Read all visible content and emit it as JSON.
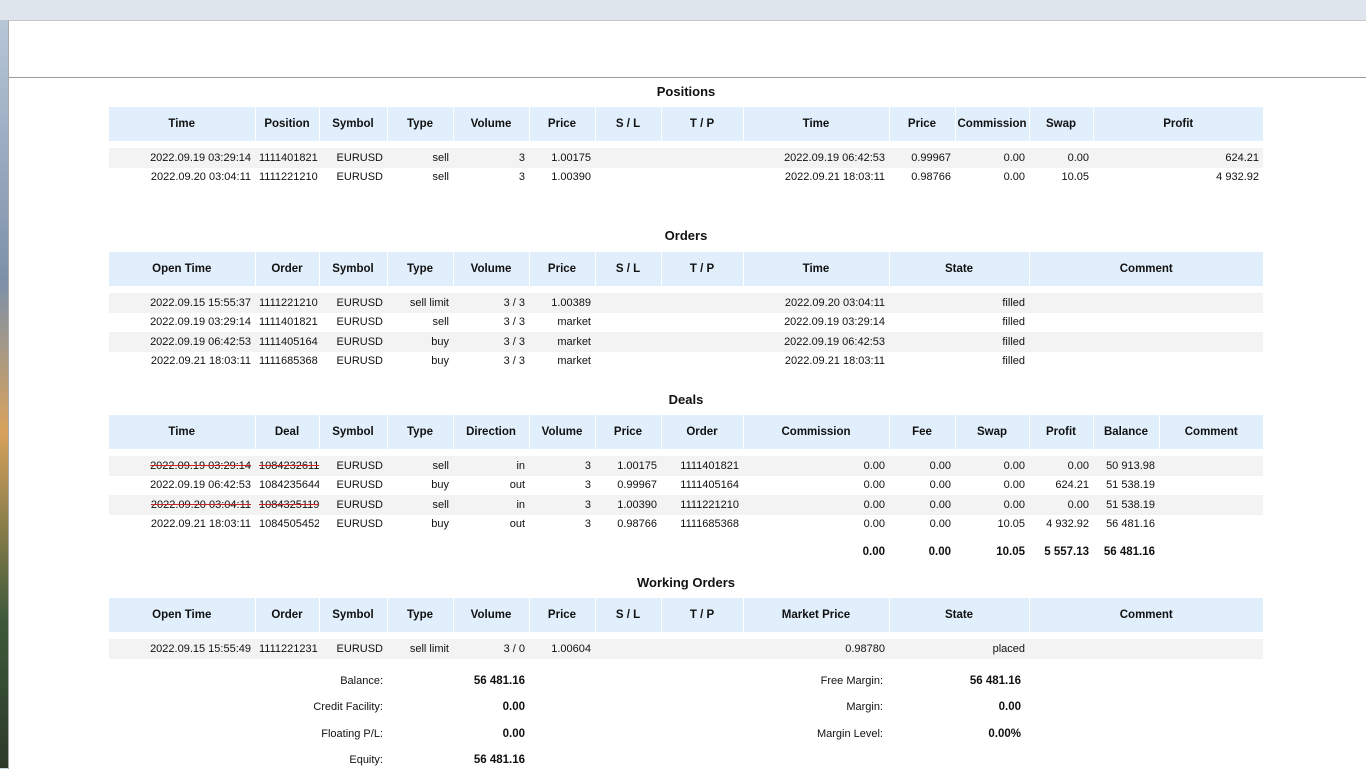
{
  "positions": {
    "title": "Positions",
    "headers": [
      "Time",
      "Position",
      "Symbol",
      "Type",
      "Volume",
      "Price",
      "S / L",
      "T / P",
      "Time",
      "Price",
      "Commission",
      "Swap",
      "Profit"
    ],
    "rows": [
      [
        "2022.09.19 03:29:14",
        "1111401821",
        "EURUSD",
        "sell",
        "3",
        "1.00175",
        "",
        "",
        "2022.09.19 06:42:53",
        "0.99967",
        "0.00",
        "0.00",
        "624.21"
      ],
      [
        "2022.09.20 03:04:11",
        "1111221210",
        "EURUSD",
        "sell",
        "3",
        "1.00390",
        "",
        "",
        "2022.09.21 18:03:11",
        "0.98766",
        "0.00",
        "10.05",
        "4 932.92"
      ]
    ]
  },
  "orders": {
    "title": "Orders",
    "headers": [
      "Open Time",
      "Order",
      "Symbol",
      "Type",
      "Volume",
      "Price",
      "S / L",
      "T / P",
      "Time",
      "State",
      "Comment"
    ],
    "rows": [
      [
        "2022.09.15 15:55:37",
        "1111221210",
        "EURUSD",
        "sell limit",
        "3 / 3",
        "1.00389",
        "",
        "",
        "2022.09.20 03:04:11",
        "filled",
        ""
      ],
      [
        "2022.09.19 03:29:14",
        "1111401821",
        "EURUSD",
        "sell",
        "3 / 3",
        "market",
        "",
        "",
        "2022.09.19 03:29:14",
        "filled",
        ""
      ],
      [
        "2022.09.19 06:42:53",
        "1111405164",
        "EURUSD",
        "buy",
        "3 / 3",
        "market",
        "",
        "",
        "2022.09.19 06:42:53",
        "filled",
        ""
      ],
      [
        "2022.09.21 18:03:11",
        "1111685368",
        "EURUSD",
        "buy",
        "3 / 3",
        "market",
        "",
        "",
        "2022.09.21 18:03:11",
        "filled",
        ""
      ]
    ]
  },
  "deals": {
    "title": "Deals",
    "headers": [
      "Time",
      "Deal",
      "Symbol",
      "Type",
      "Direction",
      "Volume",
      "Price",
      "Order",
      "Commission",
      "Fee",
      "Swap",
      "Profit",
      "Balance",
      "Comment"
    ],
    "rows": [
      [
        "2022.09.19 03:29:14",
        "1084232611",
        "EURUSD",
        "sell",
        "in",
        "3",
        "1.00175",
        "1111401821",
        "0.00",
        "0.00",
        "0.00",
        "0.00",
        "50 913.98",
        ""
      ],
      [
        "2022.09.19 06:42:53",
        "1084235644",
        "EURUSD",
        "buy",
        "out",
        "3",
        "0.99967",
        "1111405164",
        "0.00",
        "0.00",
        "0.00",
        "624.21",
        "51 538.19",
        ""
      ],
      [
        "2022.09.20 03:04:11",
        "1084325119",
        "EURUSD",
        "sell",
        "in",
        "3",
        "1.00390",
        "1111221210",
        "0.00",
        "0.00",
        "0.00",
        "0.00",
        "51 538.19",
        ""
      ],
      [
        "2022.09.21 18:03:11",
        "1084505452",
        "EURUSD",
        "buy",
        "out",
        "3",
        "0.98766",
        "1111685368",
        "0.00",
        "0.00",
        "10.05",
        "4 932.92",
        "56 481.16",
        ""
      ]
    ],
    "struck_rows": [
      0,
      2
    ],
    "totals": {
      "commission": "0.00",
      "fee": "0.00",
      "swap": "10.05",
      "profit": "5 557.13",
      "balance": "56 481.16"
    }
  },
  "working_orders": {
    "title": "Working Orders",
    "headers": [
      "Open Time",
      "Order",
      "Symbol",
      "Type",
      "Volume",
      "Price",
      "S / L",
      "T / P",
      "Market Price",
      "State",
      "Comment"
    ],
    "rows": [
      [
        "2022.09.15 15:55:49",
        "1111221231",
        "EURUSD",
        "sell limit",
        "3 / 0",
        "1.00604",
        "",
        "",
        "0.98780",
        "placed",
        ""
      ]
    ]
  },
  "summary": {
    "balance_label": "Balance:",
    "balance": "56 481.16",
    "credit_label": "Credit Facility:",
    "credit": "0.00",
    "floating_label": "Floating P/L:",
    "floating": "0.00",
    "equity_label": "Equity:",
    "equity": "56 481.16",
    "free_margin_label": "Free Margin:",
    "free_margin": "56 481.16",
    "margin_label": "Margin:",
    "margin": "0.00",
    "margin_level_label": "Margin Level:",
    "margin_level": "0.00%"
  },
  "colors": {
    "header_bg": "#e1eefb",
    "stripe_bg": "#f3f3f3",
    "strike": "#d21f1f"
  }
}
